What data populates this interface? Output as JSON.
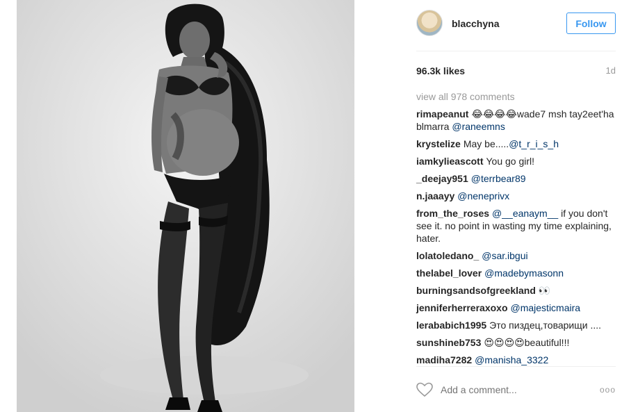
{
  "post": {
    "image_alt": "Black and white photo of a woman posing in lingerie and a fur coat"
  },
  "header": {
    "username": "blacchyna",
    "follow_label": "Follow"
  },
  "stats": {
    "likes": "96.3k likes",
    "time": "1d"
  },
  "view_all_label": "view all 978 comments",
  "comments": [
    {
      "user": "rimapeanut",
      "text": "😂😂😂😂wade7 msh tay2eet'ha blmarra ",
      "mention": "@raneemns"
    },
    {
      "user": "krystelize",
      "text": "May be.....",
      "mention": "@t_r_i_s_h"
    },
    {
      "user": "iamkylieascott",
      "text": "You go girl!",
      "mention": ""
    },
    {
      "user": "_deejay951",
      "text": "",
      "mention": "@terrbear89"
    },
    {
      "user": "n.jaaayy",
      "text": "",
      "mention": "@neneprivx"
    },
    {
      "user": "from_the_roses",
      "text": "",
      "mention": "@__eanaym__",
      "after": " if you don't see it. no point in wasting my time explaining, hater."
    },
    {
      "user": "lolatoledano_",
      "text": "",
      "mention": "@sar.ibgui"
    },
    {
      "user": "thelabel_lover",
      "text": "",
      "mention": "@madebymasonn"
    },
    {
      "user": "burningsandsofgreekland",
      "text": "👀",
      "mention": ""
    },
    {
      "user": "jenniferherreraxoxo",
      "text": "",
      "mention": "@majesticmaira"
    },
    {
      "user": "lerababich1995",
      "text": "Это пиздец,товарищи ....",
      "mention": ""
    },
    {
      "user": "sunshineb753",
      "text": "😍😍😍😍beautiful!!!",
      "mention": ""
    },
    {
      "user": "madiha7282",
      "text": "",
      "mention": "@manisha_3322"
    }
  ],
  "footer": {
    "add_comment_placeholder": "Add a comment...",
    "more_label": "ooo"
  },
  "icons": {
    "heart": "heart-icon",
    "more": "more-options-icon"
  }
}
